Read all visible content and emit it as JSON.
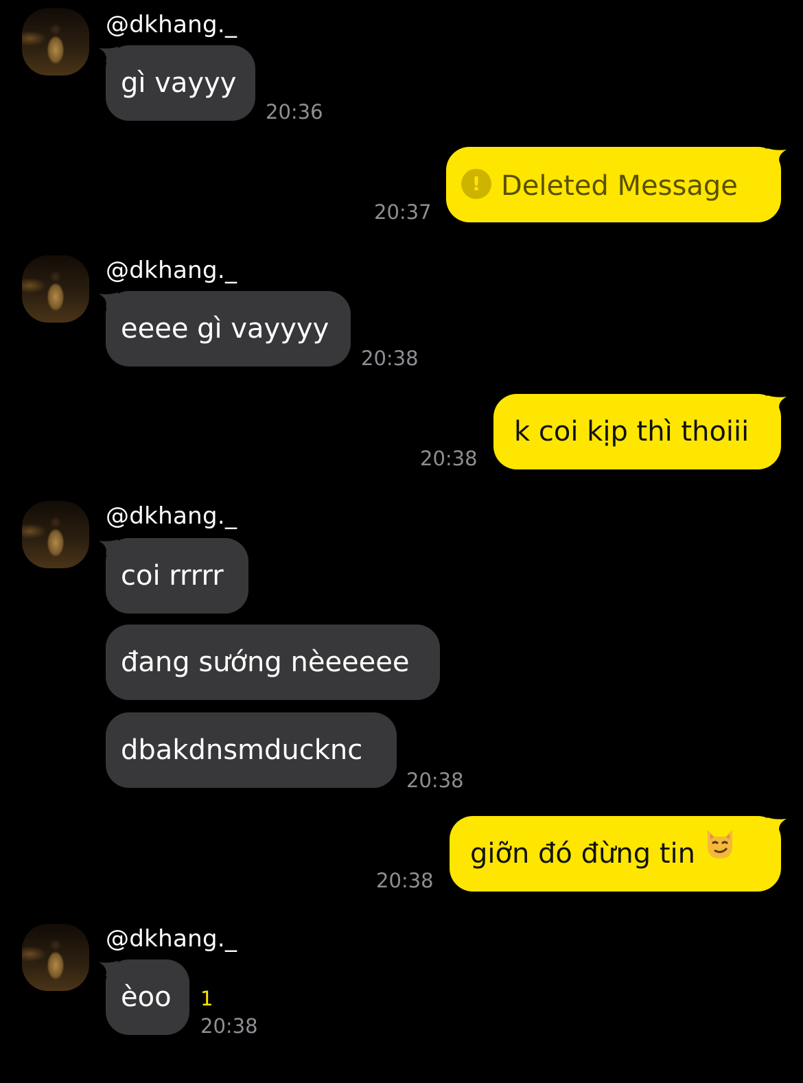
{
  "colors": {
    "background": "#000000",
    "incoming_bubble": "#38383a",
    "outgoing_bubble": "#ffe600",
    "timestamp": "#8e8e93",
    "unread": "#ffe600"
  },
  "messages": [
    {
      "sender": "@dkhang._",
      "text": "gì vayyy",
      "time": "20:36"
    },
    {
      "text": "Deleted Message",
      "time": "20:37",
      "icon": "alert-icon"
    },
    {
      "sender": "@dkhang._",
      "text": "eeee gì vayyyy",
      "time": "20:38"
    },
    {
      "text": "k coi kịp thì thoiii",
      "time": "20:38"
    },
    {
      "sender": "@dkhang._",
      "texts": [
        "coi rrrrr",
        "đang sướng nèeeeee",
        "dbakdnsmducknc"
      ],
      "time": "20:38"
    },
    {
      "text": "giỡn đó đừng tin",
      "time": "20:38",
      "emoji": "smirking-cat-icon"
    },
    {
      "sender": "@dkhang._",
      "text": "èoo",
      "unread": "1",
      "time": "20:38"
    }
  ]
}
